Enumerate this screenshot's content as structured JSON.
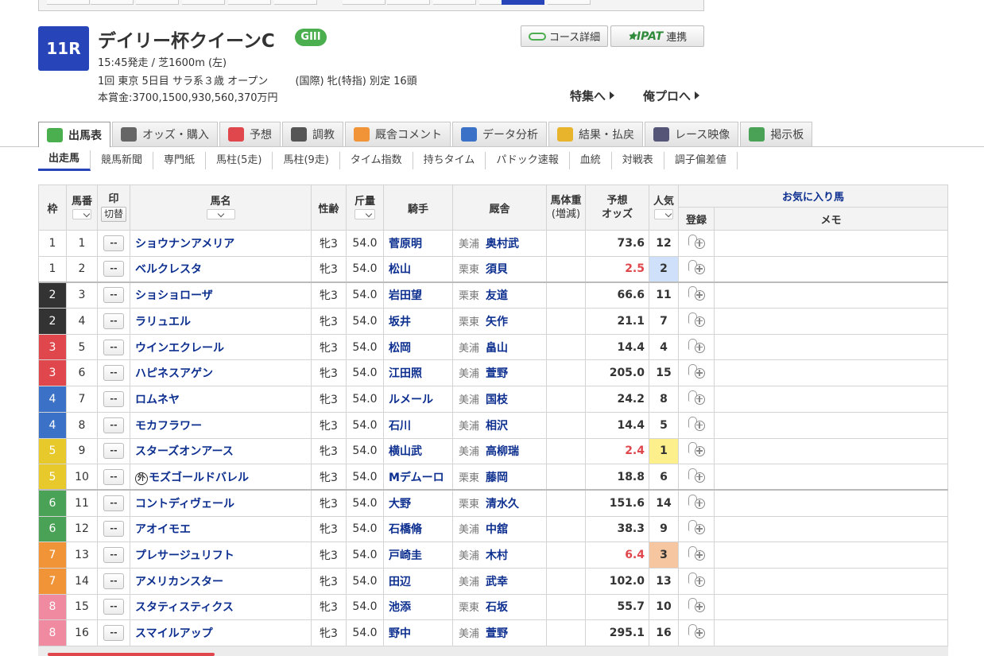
{
  "race": {
    "number": "11R",
    "name": "デイリー杯クイーンC",
    "grade": "GIII",
    "line1": "15:45発走 / 芝1600m (左)",
    "line2a": "1回 東京 5日目 サラ系３歳 オープン",
    "line2b": "(国際) 牝(特指) 別定 16頭",
    "line3": "本賞金:3700,1500,930,560,370万円"
  },
  "header_buttons": {
    "course": "コース詳細",
    "ipat_logo": "IPAT",
    "ipat_label": "連携"
  },
  "links": {
    "feature": "特集へ",
    "orepro": "俺プロへ"
  },
  "tabs": [
    {
      "label": "出馬表",
      "icon": "table-icon",
      "color": "#4bae4f"
    },
    {
      "label": "オッズ・購入",
      "icon": "odds-icon",
      "color": "#666666"
    },
    {
      "label": "予想",
      "icon": "target-icon",
      "color": "#e0474c"
    },
    {
      "label": "調教",
      "icon": "stopwatch-icon",
      "color": "#555555"
    },
    {
      "label": "厩舎コメント",
      "icon": "stable-icon",
      "color": "#f09437"
    },
    {
      "label": "データ分析",
      "icon": "bar-chart-icon",
      "color": "#3b72c7"
    },
    {
      "label": "結果・払戻",
      "icon": "coins-icon",
      "color": "#e8b42c"
    },
    {
      "label": "レース映像",
      "icon": "video-icon",
      "color": "#555577"
    },
    {
      "label": "掲示板",
      "icon": "chat-icon",
      "color": "#4aa256"
    }
  ],
  "subnav": [
    "出走馬",
    "競馬新聞",
    "専門紙",
    "馬柱(5走)",
    "馬柱(9走)",
    "タイム指数",
    "持ちタイム",
    "パドック速報",
    "血統",
    "対戦表",
    "調子偏差値"
  ],
  "table_headers": {
    "waku": "枠",
    "umaban": "馬番",
    "mark": "印",
    "mark_switch": "切替",
    "name": "馬名",
    "sex_age": "性齢",
    "weight": "斤量",
    "jockey": "騎手",
    "trainer": "厩舎",
    "body_weight": "馬体重",
    "body_weight_sub": "(増減)",
    "odds_top": "予想",
    "odds_bottom": "オッズ",
    "popularity": "人気",
    "favorites": "お気に入り馬",
    "register": "登録",
    "memo": "メモ"
  },
  "mark_placeholder": "--",
  "foreign_badge": "外",
  "horses": [
    {
      "waku": "1",
      "umaban": "1",
      "name": "ショウナンアメリア",
      "foreign": false,
      "sex_age": "牝3",
      "weight": "54.0",
      "jockey": "菅原明",
      "region": "美浦",
      "trainer": "奥村武",
      "odds": "73.6",
      "pop": "12"
    },
    {
      "waku": "1",
      "umaban": "2",
      "name": "ベルクレスタ",
      "foreign": false,
      "sex_age": "牝3",
      "weight": "54.0",
      "jockey": "松山",
      "region": "栗東",
      "trainer": "須貝",
      "odds": "2.5",
      "pop": "2"
    },
    {
      "waku": "2",
      "umaban": "3",
      "name": "ショショローザ",
      "foreign": false,
      "sex_age": "牝3",
      "weight": "54.0",
      "jockey": "岩田望",
      "region": "栗東",
      "trainer": "友道",
      "odds": "66.6",
      "pop": "11"
    },
    {
      "waku": "2",
      "umaban": "4",
      "name": "ラリュエル",
      "foreign": false,
      "sex_age": "牝3",
      "weight": "54.0",
      "jockey": "坂井",
      "region": "栗東",
      "trainer": "矢作",
      "odds": "21.1",
      "pop": "7"
    },
    {
      "waku": "3",
      "umaban": "5",
      "name": "ウインエクレール",
      "foreign": false,
      "sex_age": "牝3",
      "weight": "54.0",
      "jockey": "松岡",
      "region": "美浦",
      "trainer": "畠山",
      "odds": "14.4",
      "pop": "4"
    },
    {
      "waku": "3",
      "umaban": "6",
      "name": "ハピネスアゲン",
      "foreign": false,
      "sex_age": "牝3",
      "weight": "54.0",
      "jockey": "江田照",
      "region": "美浦",
      "trainer": "萱野",
      "odds": "205.0",
      "pop": "15"
    },
    {
      "waku": "4",
      "umaban": "7",
      "name": "ロムネヤ",
      "foreign": false,
      "sex_age": "牝3",
      "weight": "54.0",
      "jockey": "ルメール",
      "region": "美浦",
      "trainer": "国枝",
      "odds": "24.2",
      "pop": "8"
    },
    {
      "waku": "4",
      "umaban": "8",
      "name": "モカフラワー",
      "foreign": false,
      "sex_age": "牝3",
      "weight": "54.0",
      "jockey": "石川",
      "region": "美浦",
      "trainer": "相沢",
      "odds": "14.4",
      "pop": "5"
    },
    {
      "waku": "5",
      "umaban": "9",
      "name": "スターズオンアース",
      "foreign": false,
      "sex_age": "牝3",
      "weight": "54.0",
      "jockey": "横山武",
      "region": "美浦",
      "trainer": "高柳瑞",
      "odds": "2.4",
      "pop": "1"
    },
    {
      "waku": "5",
      "umaban": "10",
      "name": "モズゴールドバレル",
      "foreign": true,
      "sex_age": "牝3",
      "weight": "54.0",
      "jockey": "Mデムーロ",
      "region": "栗東",
      "trainer": "藤岡",
      "odds": "18.8",
      "pop": "6"
    },
    {
      "waku": "6",
      "umaban": "11",
      "name": "コントディヴェール",
      "foreign": false,
      "sex_age": "牝3",
      "weight": "54.0",
      "jockey": "大野",
      "region": "栗東",
      "trainer": "清水久",
      "odds": "151.6",
      "pop": "14"
    },
    {
      "waku": "6",
      "umaban": "12",
      "name": "アオイモエ",
      "foreign": false,
      "sex_age": "牝3",
      "weight": "54.0",
      "jockey": "石橋脩",
      "region": "美浦",
      "trainer": "中舘",
      "odds": "38.3",
      "pop": "9"
    },
    {
      "waku": "7",
      "umaban": "13",
      "name": "プレサージュリフト",
      "foreign": false,
      "sex_age": "牝3",
      "weight": "54.0",
      "jockey": "戸崎圭",
      "region": "美浦",
      "trainer": "木村",
      "odds": "6.4",
      "pop": "3"
    },
    {
      "waku": "7",
      "umaban": "14",
      "name": "アメリカンスター",
      "foreign": false,
      "sex_age": "牝3",
      "weight": "54.0",
      "jockey": "田辺",
      "region": "美浦",
      "trainer": "武幸",
      "odds": "102.0",
      "pop": "13"
    },
    {
      "waku": "8",
      "umaban": "15",
      "name": "スタティスティクス",
      "foreign": false,
      "sex_age": "牝3",
      "weight": "54.0",
      "jockey": "池添",
      "region": "栗東",
      "trainer": "石坂",
      "odds": "55.7",
      "pop": "10"
    },
    {
      "waku": "8",
      "umaban": "16",
      "name": "スマイルアップ",
      "foreign": false,
      "sex_age": "牝3",
      "weight": "54.0",
      "jockey": "野中",
      "region": "美浦",
      "trainer": "萱野",
      "odds": "295.1",
      "pop": "16"
    }
  ]
}
